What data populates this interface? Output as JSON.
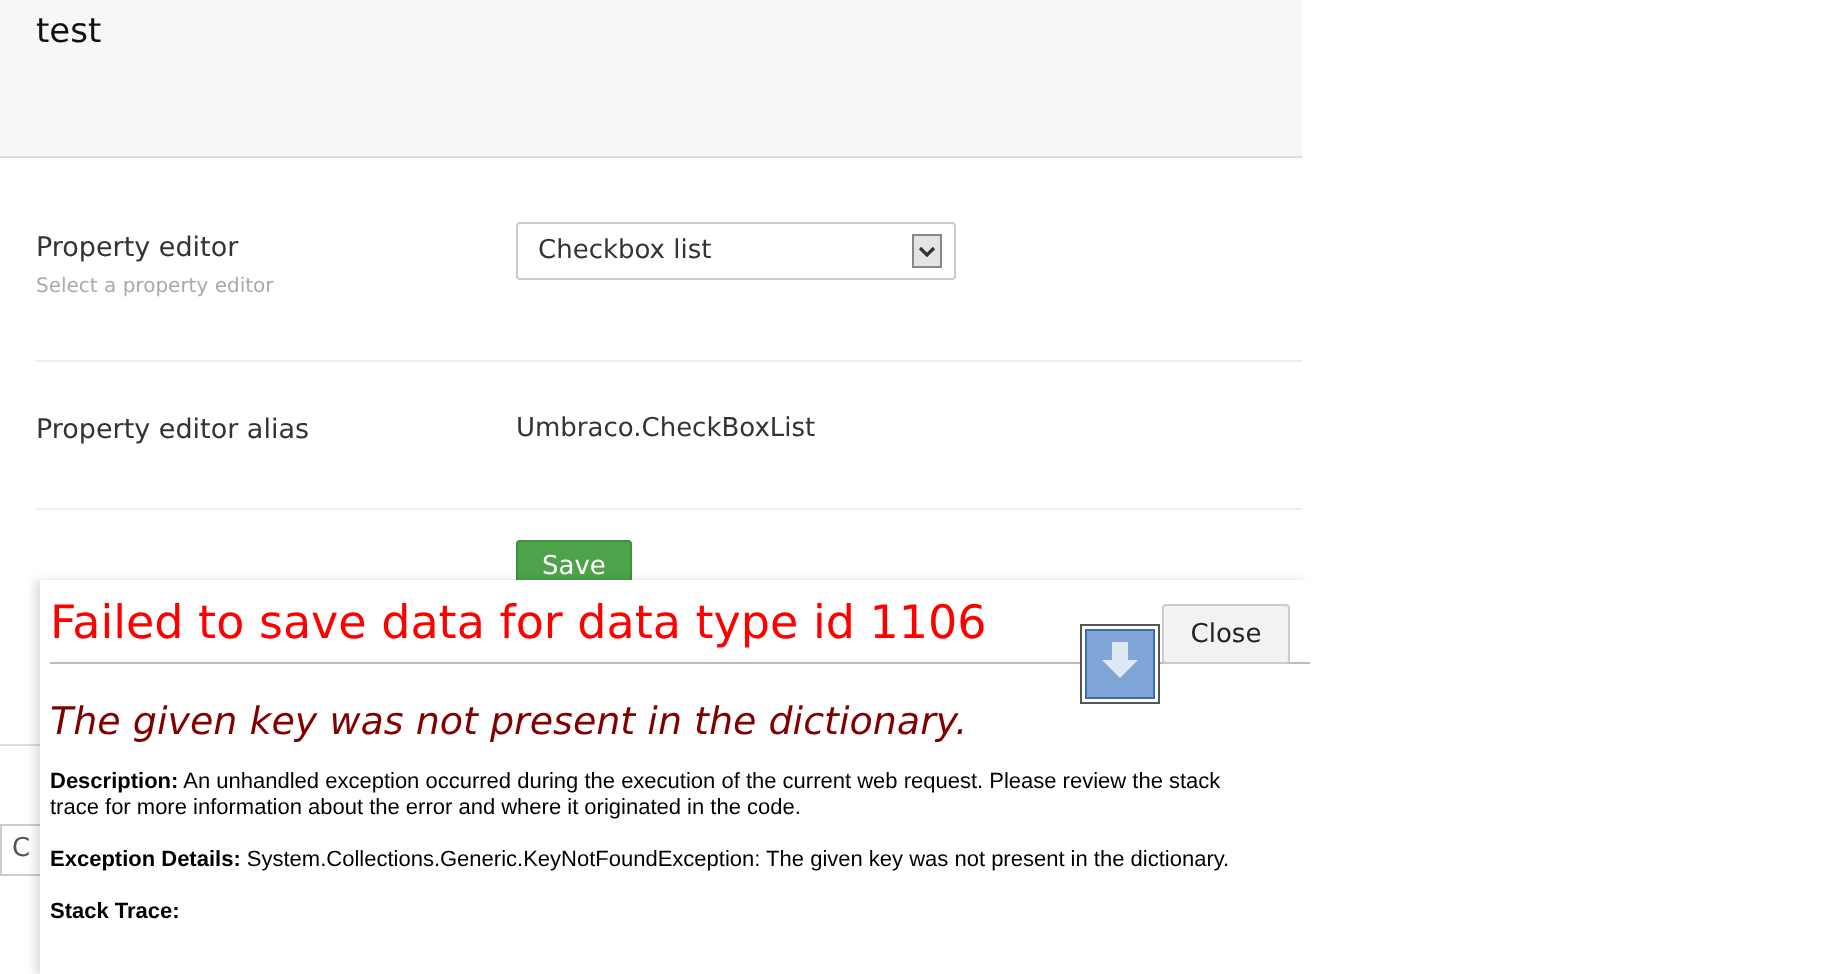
{
  "header": {
    "title": "test"
  },
  "fields": [
    {
      "kind": "select",
      "label": "Property editor",
      "description": "Select a property editor",
      "value": "Checkbox list"
    },
    {
      "kind": "text",
      "label": "Property editor alias",
      "value": "Umbraco.CheckBoxList"
    }
  ],
  "save_button": "Save",
  "background_field": {
    "value": "C"
  },
  "error_dialog": {
    "title": "Failed to save data for data type id 1106",
    "close_button": "Close",
    "message": "The given key was not present in the dictionary.",
    "details": [
      "**Description:** An unhandled exception occurred during the execution of the current web request. Please review the stack trace for more information about the error and where it originated in the code.",
      "**Exception Details:** System.Collections.Generic.KeyNotFoundException: The given key was not present in the dictionary."
    ],
    "stack_trace_label": "Stack Trace:"
  }
}
